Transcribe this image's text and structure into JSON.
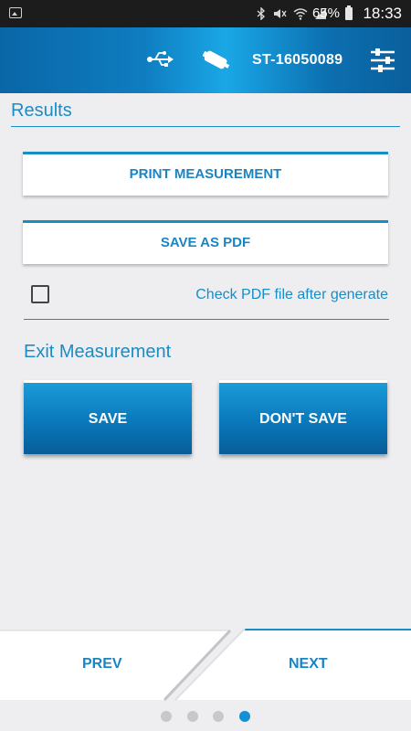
{
  "status_bar": {
    "battery": "65%",
    "time": "18:33",
    "icons": [
      "image-icon",
      "bluetooth-icon",
      "mute-icon",
      "wifi-icon",
      "signal-icon",
      "battery-icon"
    ]
  },
  "header": {
    "device_id": "ST-16050089",
    "icons": [
      "usb-icon",
      "device-icon",
      "settings-sliders-icon"
    ]
  },
  "results": {
    "title": "Results",
    "print_label": "PRINT MEASUREMENT",
    "pdf_label": "SAVE AS PDF",
    "check_label": "Check PDF file after generate",
    "checked": false
  },
  "exit": {
    "title": "Exit Measurement",
    "save_label": "SAVE",
    "dont_save_label": "DON'T SAVE"
  },
  "nav": {
    "prev_label": "PREV",
    "next_label": "NEXT",
    "page_count": 4,
    "current_page": 4
  },
  "colors": {
    "accent": "#1a8cc6",
    "header_dark": "#0a66a7",
    "button_blue": "#0a78bb",
    "background": "#eeeef0"
  }
}
